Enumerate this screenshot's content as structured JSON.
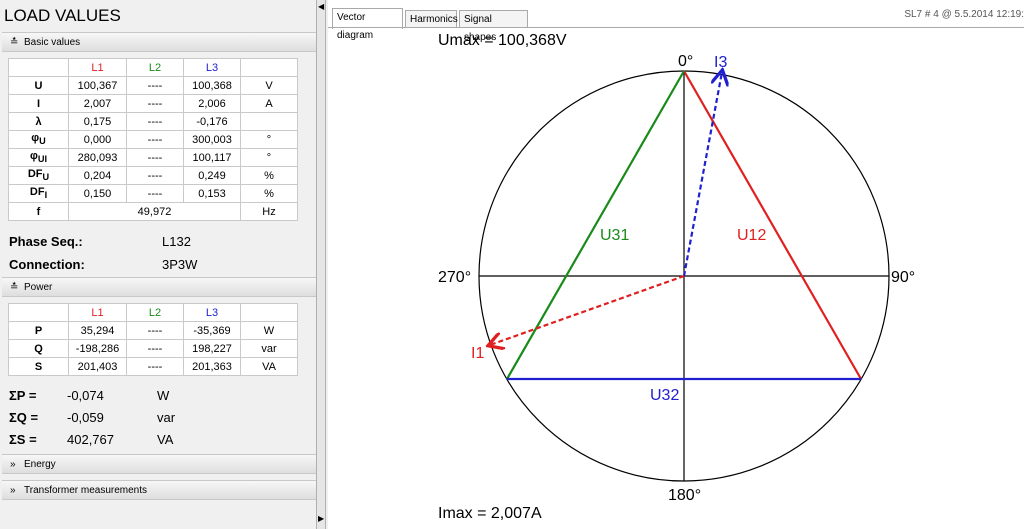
{
  "title": "LOAD VALUES",
  "sections": {
    "basic": "Basic values",
    "power": "Power",
    "energy": "Energy",
    "transformer": "Transformer measurements"
  },
  "basic_table": {
    "headers": [
      "",
      "L1",
      "L2",
      "L3",
      ""
    ],
    "rows": [
      [
        "U",
        "100,367",
        "----",
        "100,368",
        "V"
      ],
      [
        "I",
        "2,007",
        "----",
        "2,006",
        "A"
      ],
      [
        "λ",
        "0,175",
        "----",
        "-0,176",
        ""
      ],
      [
        "φ",
        "0,000",
        "----",
        "300,003",
        "°"
      ],
      [
        "φ",
        "280,093",
        "----",
        "100,117",
        "°"
      ],
      [
        "DF",
        "0,204",
        "----",
        "0,249",
        "%"
      ],
      [
        "DF",
        "0,150",
        "----",
        "0,153",
        "%"
      ]
    ],
    "subscripts": [
      "U",
      "UI",
      "U",
      "I"
    ],
    "freq_label": "f",
    "freq_value": "49,972",
    "freq_unit": "Hz"
  },
  "phase_seq": {
    "label": "Phase Seq.:",
    "value": "L132"
  },
  "connection": {
    "label": "Connection:",
    "value": "3P3W"
  },
  "power_table": {
    "headers": [
      "",
      "L1",
      "L2",
      "L3",
      ""
    ],
    "rows": [
      [
        "P",
        "35,294",
        "----",
        "-35,369",
        "W"
      ],
      [
        "Q",
        "-198,286",
        "----",
        "198,227",
        "var"
      ],
      [
        "S",
        "201,403",
        "----",
        "201,363",
        "VA"
      ]
    ]
  },
  "totals": [
    {
      "label": "ΣP =",
      "value": "-0,074",
      "unit": "W"
    },
    {
      "label": "ΣQ =",
      "value": "-0,059",
      "unit": "var"
    },
    {
      "label": "ΣS =",
      "value": "402,767",
      "unit": "VA"
    }
  ],
  "tabs": [
    "Vector diagram",
    "Harmonics",
    "Signal shapes"
  ],
  "status": "SL7 # 4 @ 5.5.2014 12:19:",
  "diagram": {
    "umax": "Umax = 100,368V",
    "imax": "Imax = 2,007A",
    "angles": [
      "0°",
      "90°",
      "180°",
      "270°"
    ],
    "labels": {
      "u12": "U12",
      "u31": "U31",
      "u32": "U32",
      "i1": "I1",
      "i3": "I3"
    },
    "colors": {
      "l1": "#e02020",
      "l2": "#1a8a1a",
      "l3": "#2020d0"
    }
  }
}
